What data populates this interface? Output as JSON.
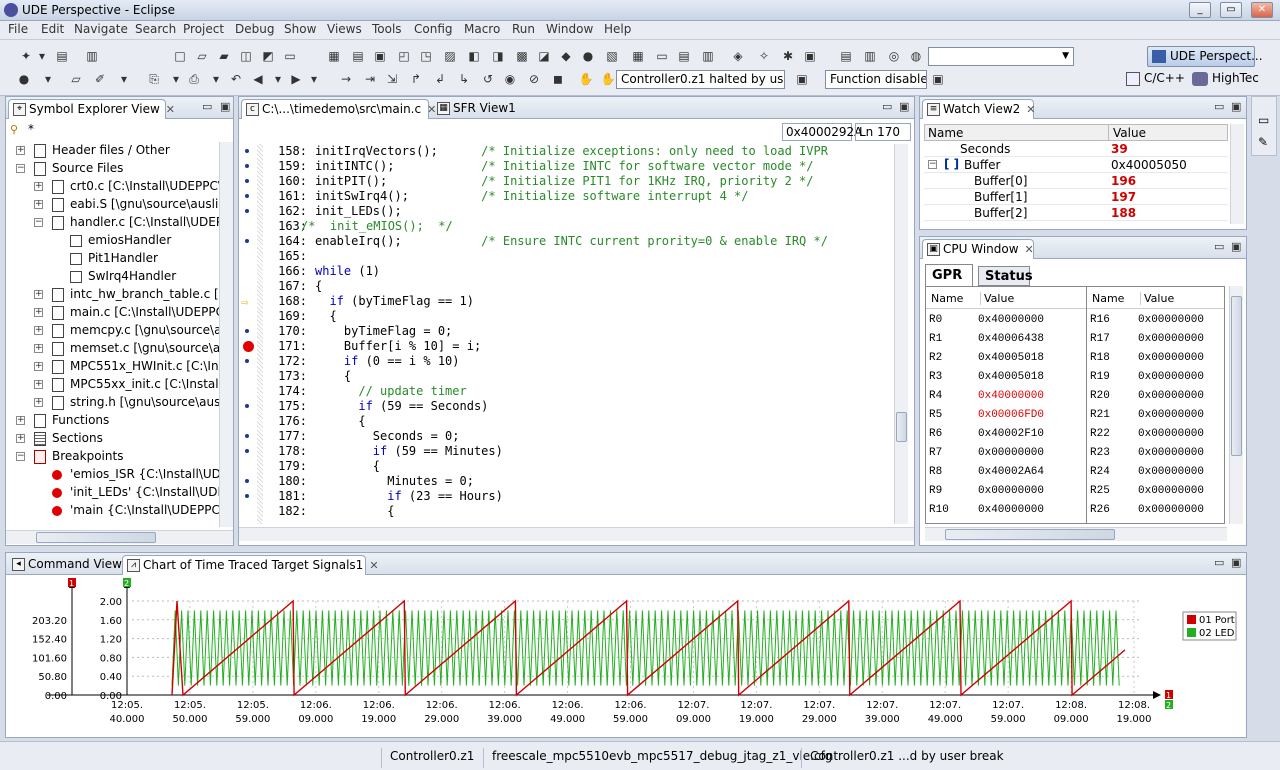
{
  "window": {
    "title": "UDE Perspective - Eclipse"
  },
  "menu": [
    "File",
    "Edit",
    "Navigate",
    "Search",
    "Project",
    "Debug",
    "Show",
    "Views",
    "Tools",
    "Config",
    "Macro",
    "Run",
    "Window",
    "Help"
  ],
  "toolbar": {
    "status_field": "Controller0.z1 halted by user br",
    "function_field": "Function disabled",
    "perspective_button": "UDE Perspect...",
    "perspective_cpp": "C/C++",
    "perspective_hightec": "HighTec"
  },
  "symbol_explorer": {
    "tab": "Symbol Explorer View",
    "root": "*",
    "items": [
      {
        "label": "Header files / Other",
        "indent": 0,
        "exp": "+",
        "icon": "file"
      },
      {
        "label": "Source Files",
        "indent": 0,
        "exp": "-",
        "icon": "file"
      },
      {
        "label": "crt0.c [C:\\Install\\UDEPPC\\High",
        "indent": 1,
        "exp": "+",
        "icon": "file"
      },
      {
        "label": "eabi.S [\\gnu\\source\\auslieferu",
        "indent": 1,
        "exp": "+",
        "icon": "file"
      },
      {
        "label": "handler.c [C:\\Install\\UDEPPC\\I",
        "indent": 1,
        "exp": "-",
        "icon": "file"
      },
      {
        "label": "emiosHandler",
        "indent": 2,
        "exp": "",
        "icon": "func"
      },
      {
        "label": "Pit1Handler",
        "indent": 2,
        "exp": "",
        "icon": "func"
      },
      {
        "label": "SwIrq4Handler",
        "indent": 2,
        "exp": "",
        "icon": "func"
      },
      {
        "label": "intc_hw_branch_table.c [C:\\Inst",
        "indent": 1,
        "exp": "+",
        "icon": "file"
      },
      {
        "label": "main.c [C:\\Install\\UDEPPC\\High",
        "indent": 1,
        "exp": "+",
        "icon": "file"
      },
      {
        "label": "memcpy.c [\\gnu\\source\\ausli",
        "indent": 1,
        "exp": "+",
        "icon": "file"
      },
      {
        "label": "memset.c [\\gnu\\source\\auslie",
        "indent": 1,
        "exp": "+",
        "icon": "file"
      },
      {
        "label": "MPC551x_HWInit.c [C:\\Install\\",
        "indent": 1,
        "exp": "+",
        "icon": "file"
      },
      {
        "label": "MPC55xx_init.c [C:\\Install\\UDE",
        "indent": 1,
        "exp": "+",
        "icon": "file"
      },
      {
        "label": "string.h [\\gnu\\source\\ausliefe",
        "indent": 1,
        "exp": "+",
        "icon": "file"
      },
      {
        "label": "Functions",
        "indent": 0,
        "exp": "+",
        "icon": "file"
      },
      {
        "label": "Sections",
        "indent": 0,
        "exp": "+",
        "icon": "list"
      },
      {
        "label": "Breakpoints",
        "indent": 0,
        "exp": "-",
        "icon": "bp"
      },
      {
        "label": "'emios_ISR {C:\\Install\\UDEPPC",
        "indent": 1,
        "exp": "",
        "icon": "dot"
      },
      {
        "label": "'init_LEDs' {C:\\Install\\UDEPPC\\",
        "indent": 1,
        "exp": "",
        "icon": "dot"
      },
      {
        "label": "'main {C:\\Install\\UDEPPC\\High",
        "indent": 1,
        "exp": "",
        "icon": "dot"
      }
    ]
  },
  "editor": {
    "tabs": [
      "C:\\...\\timedemo\\src\\main.c",
      "SFR View1"
    ],
    "address": "0x4000292A",
    "line_indicator": "Ln 170",
    "lines": [
      {
        "n": "158:",
        "t": "initIrqVectors();      ",
        "c": "/* Initialize exceptions: only need to load IVPR",
        "m": "dot"
      },
      {
        "n": "159:",
        "t": "initINTC();            ",
        "c": "/* Initialize INTC for software vector mode */",
        "m": "dot"
      },
      {
        "n": "160:",
        "t": "initPIT();             ",
        "c": "/* Initialize PIT1 for 1KHz IRQ, priority 2 */",
        "m": "dot"
      },
      {
        "n": "161:",
        "t": "initSwIrq4();          ",
        "c": "/* Initialize software interrupt 4 */",
        "m": "dot"
      },
      {
        "n": "162:",
        "t": "init_LEDs();",
        "c": "",
        "m": "dot"
      },
      {
        "n": "163:",
        "t": "",
        "c": "/*  init_eMIOS();  */",
        "m": "",
        "pre": "-2"
      },
      {
        "n": "164:",
        "t": "enableIrq();           ",
        "c": "/* Ensure INTC current prority=0 & enable IRQ */",
        "m": "dot"
      },
      {
        "n": "165:",
        "t": "",
        "c": "",
        "m": ""
      },
      {
        "n": "166:",
        "t": "while (1)",
        "c": "",
        "m": "",
        "kw": "while"
      },
      {
        "n": "167:",
        "t": "{",
        "c": "",
        "m": ""
      },
      {
        "n": "168:",
        "t": "  if (byTimeFlag == 1)",
        "c": "",
        "m": "arrow",
        "kw": "if"
      },
      {
        "n": "169:",
        "t": "  {",
        "c": "",
        "m": ""
      },
      {
        "n": "170:",
        "t": "    byTimeFlag = 0;",
        "c": "",
        "m": "dot"
      },
      {
        "n": "171:",
        "t": "    Buffer[i % 10] = i;",
        "c": "",
        "m": "bp"
      },
      {
        "n": "172:",
        "t": "    if (0 == i % 10)",
        "c": "",
        "m": "dot",
        "kw": "if"
      },
      {
        "n": "173:",
        "t": "    {",
        "c": "",
        "m": ""
      },
      {
        "n": "174:",
        "t": "      ",
        "c": "// update timer",
        "m": ""
      },
      {
        "n": "175:",
        "t": "      if (59 == Seconds)",
        "c": "",
        "m": "dot",
        "kw": "if"
      },
      {
        "n": "176:",
        "t": "      {",
        "c": "",
        "m": ""
      },
      {
        "n": "177:",
        "t": "        Seconds = 0;",
        "c": "",
        "m": "dot"
      },
      {
        "n": "178:",
        "t": "        if (59 == Minutes)",
        "c": "",
        "m": "dot",
        "kw": "if"
      },
      {
        "n": "179:",
        "t": "        {",
        "c": "",
        "m": ""
      },
      {
        "n": "180:",
        "t": "          Minutes = 0;",
        "c": "",
        "m": "dot"
      },
      {
        "n": "181:",
        "t": "          if (23 == Hours)",
        "c": "",
        "m": "dot",
        "kw": "if"
      },
      {
        "n": "182:",
        "t": "          {",
        "c": "",
        "m": ""
      }
    ]
  },
  "watch": {
    "tab": "Watch View2",
    "col_name": "Name",
    "col_value": "Value",
    "rows": [
      {
        "name": "Seconds",
        "value": "39",
        "indent": 0,
        "red": true
      },
      {
        "name": "Buffer",
        "value": "0x40005050",
        "indent": 0,
        "red": false,
        "exp": "-"
      },
      {
        "name": "Buffer[0]",
        "value": "196",
        "indent": 1,
        "red": true
      },
      {
        "name": "Buffer[1]",
        "value": "197",
        "indent": 1,
        "red": true
      },
      {
        "name": "Buffer[2]",
        "value": "188",
        "indent": 1,
        "red": true
      }
    ]
  },
  "cpu": {
    "tab": "CPU Window",
    "subtabs": [
      "GPR",
      "Status"
    ],
    "col_name": "Name",
    "col_value": "Value",
    "left": [
      {
        "n": "R0",
        "v": "0x40000000",
        "red": false
      },
      {
        "n": "R1",
        "v": "0x40006438",
        "red": false
      },
      {
        "n": "R2",
        "v": "0x40005018",
        "red": false
      },
      {
        "n": "R3",
        "v": "0x40005018",
        "red": false
      },
      {
        "n": "R4",
        "v": "0x40000000",
        "red": true
      },
      {
        "n": "R5",
        "v": "0x00006FD0",
        "red": true
      },
      {
        "n": "R6",
        "v": "0x40002F10",
        "red": false
      },
      {
        "n": "R7",
        "v": "0x00000000",
        "red": false
      },
      {
        "n": "R8",
        "v": "0x40002A64",
        "red": false
      },
      {
        "n": "R9",
        "v": "0x00000000",
        "red": false
      },
      {
        "n": "R10",
        "v": "0x40000000",
        "red": false
      }
    ],
    "right": [
      {
        "n": "R16",
        "v": "0x00000000"
      },
      {
        "n": "R17",
        "v": "0x00000000"
      },
      {
        "n": "R18",
        "v": "0x00000000"
      },
      {
        "n": "R19",
        "v": "0x00000000"
      },
      {
        "n": "R20",
        "v": "0x00000000"
      },
      {
        "n": "R21",
        "v": "0x00000000"
      },
      {
        "n": "R22",
        "v": "0x00000000"
      },
      {
        "n": "R23",
        "v": "0x00000000"
      },
      {
        "n": "R24",
        "v": "0x00000000"
      },
      {
        "n": "R25",
        "v": "0x00000000"
      },
      {
        "n": "R26",
        "v": "0x00000000"
      }
    ]
  },
  "bottom": {
    "tabs": [
      "Command View",
      "Chart of Time Traced Target Signals1"
    ]
  },
  "chart_data": {
    "type": "line",
    "title": "",
    "axis_markers": {
      "left_red": "1",
      "left_green": "2",
      "right_red": "1",
      "right_green": "2"
    },
    "y_ticks_left": [
      "203.20",
      "152.40",
      "101.60",
      "50.80",
      "0.00"
    ],
    "y_ticks_left_values": [
      203.2,
      152.4,
      101.6,
      50.8,
      0
    ],
    "y_ticks_right": [
      "2.00",
      "1.60",
      "1.20",
      "0.80",
      "0.40",
      "0.00"
    ],
    "y_ticks_right_values": [
      2.0,
      1.6,
      1.2,
      0.8,
      0.4,
      0
    ],
    "ylim_left": [
      0,
      254.0
    ],
    "ylim_right": [
      0,
      2.0
    ],
    "x_ticks": [
      {
        "l1": "12:05.",
        "l2": "40.000"
      },
      {
        "l1": "12:05.",
        "l2": "50.000"
      },
      {
        "l1": "12:05.",
        "l2": "59.000"
      },
      {
        "l1": "12:06.",
        "l2": "09.000"
      },
      {
        "l1": "12:06.",
        "l2": "19.000"
      },
      {
        "l1": "12:06.",
        "l2": "29.000"
      },
      {
        "l1": "12:06.",
        "l2": "39.000"
      },
      {
        "l1": "12:06.",
        "l2": "49.000"
      },
      {
        "l1": "12:06.",
        "l2": "59.000"
      },
      {
        "l1": "12:07.",
        "l2": "09.000"
      },
      {
        "l1": "12:07.",
        "l2": "19.000"
      },
      {
        "l1": "12:07.",
        "l2": "29.000"
      },
      {
        "l1": "12:07.",
        "l2": "39.000"
      },
      {
        "l1": "12:07.",
        "l2": "49.000"
      },
      {
        "l1": "12:07.",
        "l2": "59.000"
      },
      {
        "l1": "12:08.",
        "l2": "09.000"
      },
      {
        "l1": "12:08.",
        "l2": "19.000"
      }
    ],
    "legend_position": "top-right",
    "series": [
      {
        "name": "01 Port",
        "color": "#d00000",
        "shape": "sawtooth",
        "min": 0,
        "max": 254,
        "period_s": 17.5
      },
      {
        "name": "02 LED",
        "color": "#22b022",
        "shape": "square-toggle",
        "min": 0.2,
        "max": 1.8
      }
    ]
  },
  "statusbar": {
    "cells": [
      "Controller0.z1",
      "freescale_mpc5510evb_mpc5517_debug_jtag_z1_vle.cfg",
      "Controller0.z1 ...d by user break"
    ]
  }
}
